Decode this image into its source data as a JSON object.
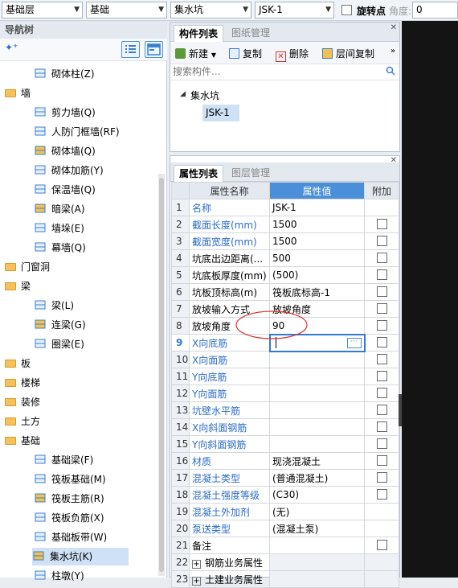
{
  "toolbar": {
    "floor": "基础层",
    "category": "基础",
    "type": "集水坑",
    "component": "JSK-1",
    "rotate_label": "旋转点",
    "angle_label": "角度:",
    "angle_value": "0"
  },
  "nav": {
    "title": "导航树",
    "items": [
      {
        "label": "砌体柱(Z)",
        "kind": "item"
      },
      {
        "label": "墙",
        "kind": "group"
      },
      {
        "label": "剪力墙(Q)",
        "kind": "item"
      },
      {
        "label": "人防门框墙(RF)",
        "kind": "item"
      },
      {
        "label": "砌体墙(Q)",
        "kind": "item"
      },
      {
        "label": "砌体加筋(Y)",
        "kind": "item"
      },
      {
        "label": "保温墙(Q)",
        "kind": "item"
      },
      {
        "label": "暗梁(A)",
        "kind": "item"
      },
      {
        "label": "墙垛(E)",
        "kind": "item"
      },
      {
        "label": "幕墙(Q)",
        "kind": "item"
      },
      {
        "label": "门窗洞",
        "kind": "group"
      },
      {
        "label": "梁",
        "kind": "group"
      },
      {
        "label": "梁(L)",
        "kind": "item"
      },
      {
        "label": "连梁(G)",
        "kind": "item"
      },
      {
        "label": "圈梁(E)",
        "kind": "item"
      },
      {
        "label": "板",
        "kind": "group"
      },
      {
        "label": "楼梯",
        "kind": "group"
      },
      {
        "label": "装修",
        "kind": "group"
      },
      {
        "label": "土方",
        "kind": "group"
      },
      {
        "label": "基础",
        "kind": "group"
      },
      {
        "label": "基础梁(F)",
        "kind": "item"
      },
      {
        "label": "筏板基础(M)",
        "kind": "item"
      },
      {
        "label": "筏板主筋(R)",
        "kind": "item"
      },
      {
        "label": "筏板负筋(X)",
        "kind": "item"
      },
      {
        "label": "基础板带(W)",
        "kind": "item"
      },
      {
        "label": "集水坑(K)",
        "kind": "item"
      },
      {
        "label": "柱墩(Y)",
        "kind": "item"
      }
    ]
  },
  "component_panel": {
    "tab_active": "构件列表",
    "tab_other": "图纸管理",
    "new": "新建",
    "copy": "复制",
    "delete": "删除",
    "floor_copy": "层间复制",
    "search_placeholder": "搜索构件...",
    "tree_root": "集水坑",
    "tree_child": "JSK-1"
  },
  "property_panel": {
    "tab_active": "属性列表",
    "tab_other": "图层管理",
    "col_name": "属性名称",
    "col_value": "属性值",
    "col_extra": "附加",
    "rows": [
      {
        "n": "1",
        "name": "名称",
        "value": "JSK-1",
        "blue": true,
        "check": false
      },
      {
        "n": "2",
        "name": "截面长度(mm)",
        "value": "1500",
        "blue": true,
        "check": true
      },
      {
        "n": "3",
        "name": "截面宽度(mm)",
        "value": "1500",
        "blue": true,
        "check": true
      },
      {
        "n": "4",
        "name": "坑底出边距离(...",
        "value": "500",
        "blue": false,
        "check": true
      },
      {
        "n": "5",
        "name": "坑底板厚度(mm)",
        "value": "(500)",
        "blue": false,
        "check": true
      },
      {
        "n": "6",
        "name": "坑板顶标高(m)",
        "value": "筏板底标高-1",
        "blue": false,
        "check": true
      },
      {
        "n": "7",
        "name": "放坡输入方式",
        "value": "放坡角度",
        "blue": false,
        "check": true
      },
      {
        "n": "8",
        "name": "放坡角度",
        "value": "90",
        "blue": false,
        "check": true
      },
      {
        "n": "9",
        "name": "X向底筋",
        "value": "",
        "blue": true,
        "check": true
      },
      {
        "n": "10",
        "name": "X向面筋",
        "value": "",
        "blue": true,
        "check": true
      },
      {
        "n": "11",
        "name": "Y向底筋",
        "value": "",
        "blue": true,
        "check": true
      },
      {
        "n": "12",
        "name": "Y向面筋",
        "value": "",
        "blue": true,
        "check": true
      },
      {
        "n": "13",
        "name": "坑壁水平筋",
        "value": "",
        "blue": true,
        "check": true
      },
      {
        "n": "14",
        "name": "X向斜面钢筋",
        "value": "",
        "blue": true,
        "check": true
      },
      {
        "n": "15",
        "name": "Y向斜面钢筋",
        "value": "",
        "blue": true,
        "check": true
      },
      {
        "n": "16",
        "name": "材质",
        "value": "现浇混凝土",
        "blue": true,
        "check": true
      },
      {
        "n": "17",
        "name": "混凝土类型",
        "value": "(普通混凝土)",
        "blue": true,
        "check": true
      },
      {
        "n": "18",
        "name": "混凝土强度等级",
        "value": "(C30)",
        "blue": true,
        "check": true
      },
      {
        "n": "19",
        "name": "混凝土外加剂",
        "value": "(无)",
        "blue": true,
        "check": false
      },
      {
        "n": "20",
        "name": "泵送类型",
        "value": "(混凝土泵)",
        "blue": true,
        "check": false
      },
      {
        "n": "21",
        "name": "备注",
        "value": "",
        "blue": false,
        "check": true
      },
      {
        "n": "22",
        "name": "钢筋业务属性",
        "value": "",
        "blue": false,
        "check": false,
        "expand": true
      },
      {
        "n": "23",
        "name": "土建业务属性",
        "value": "",
        "blue": false,
        "check": false,
        "expand": true
      }
    ]
  },
  "colors": {
    "accent": "#4a8fd8",
    "link": "#2b6cc4",
    "highlight_circle": "#e03030"
  }
}
